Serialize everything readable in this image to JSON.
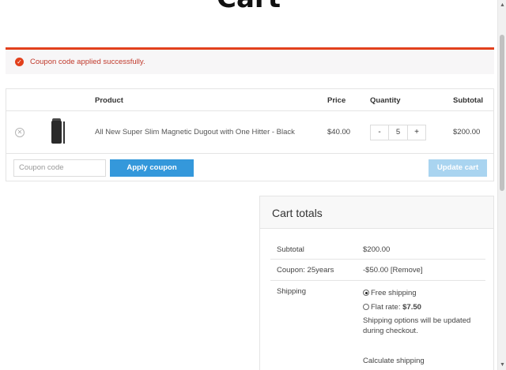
{
  "page": {
    "title": "Cart"
  },
  "notice": {
    "message": "Coupon code applied successfully.",
    "icon": "check-circle-icon",
    "accent": "#e2401c"
  },
  "table": {
    "headers": {
      "product": "Product",
      "price": "Price",
      "quantity": "Quantity",
      "subtotal": "Subtotal"
    },
    "item": {
      "name": "All New Super Slim Magnetic Dugout with One Hitter - Black",
      "price": "$40.00",
      "quantity": "5",
      "subtotal": "$200.00",
      "remove_icon": "close-circle-icon",
      "minus": "-",
      "plus": "+"
    },
    "coupon": {
      "placeholder": "Coupon code",
      "apply_label": "Apply coupon",
      "update_label": "Update cart"
    }
  },
  "totals": {
    "heading": "Cart totals",
    "subtotal_label": "Subtotal",
    "subtotal_value": "$200.00",
    "coupon_label": "Coupon: 25years",
    "coupon_value": "-$50.00",
    "coupon_remove": "[Remove]",
    "shipping_label": "Shipping",
    "free_shipping": "Free shipping",
    "flat_rate_label": "Flat rate:",
    "flat_rate_value": "$7.50",
    "shipping_note": "Shipping options will be updated during checkout.",
    "calculate_shipping": "Calculate shipping"
  },
  "colors": {
    "apply_button": "#3498db",
    "update_button": "#a9d4f0",
    "notice_text": "#c0392b"
  }
}
